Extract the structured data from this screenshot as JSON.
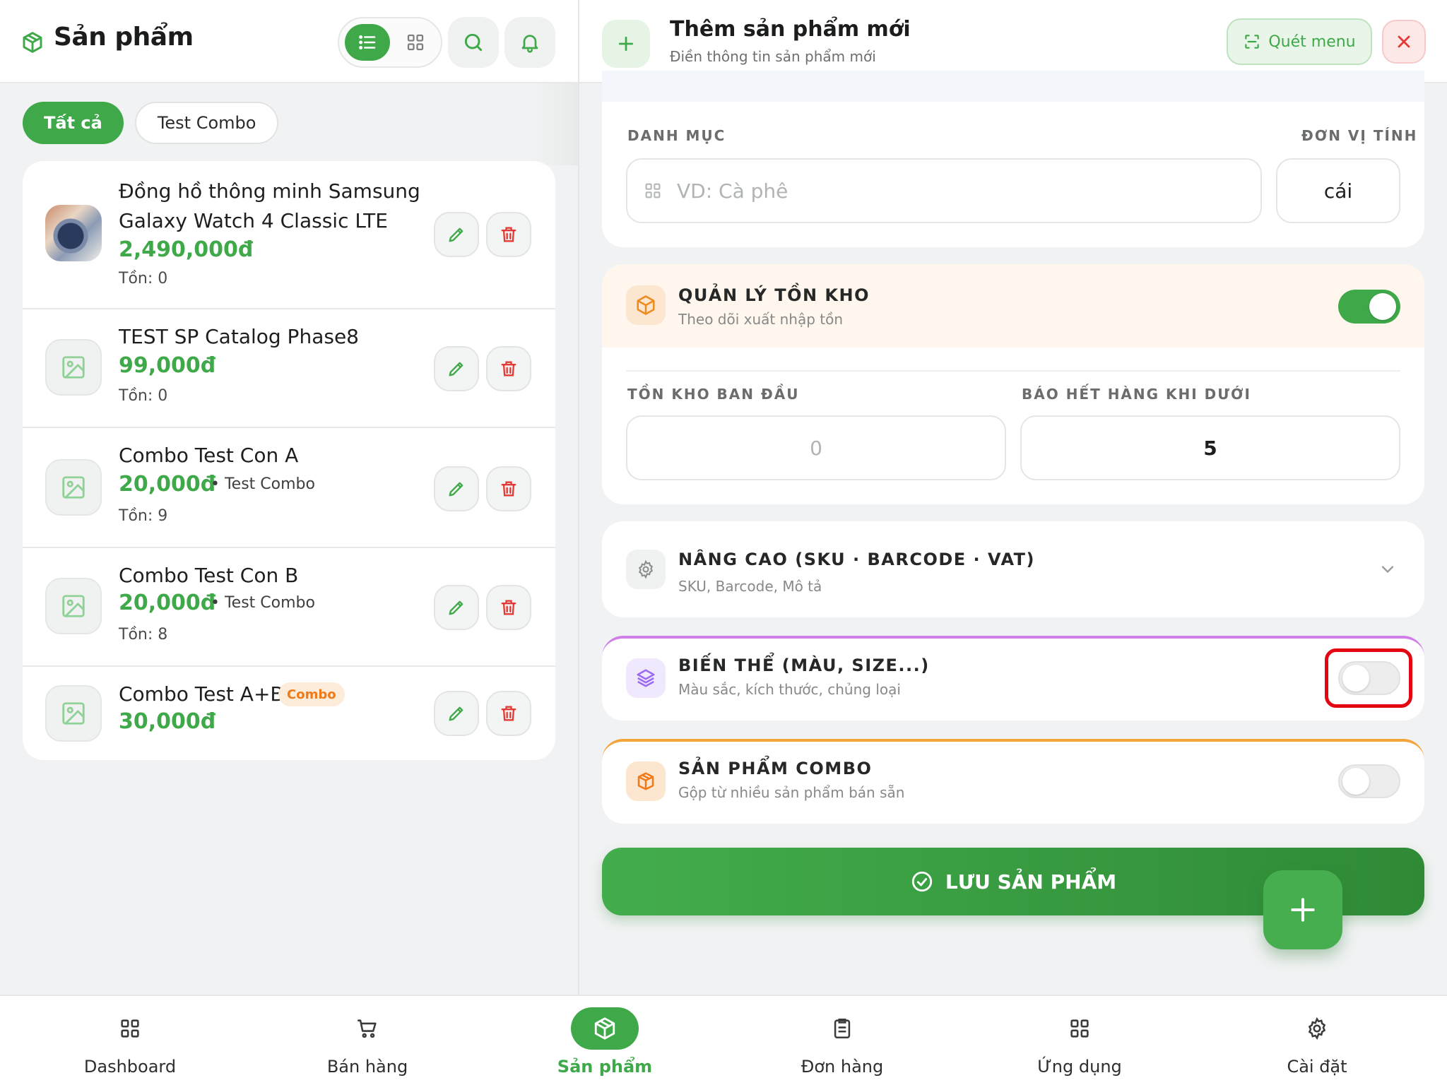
{
  "products_pane": {
    "title": "Sản phẩm",
    "filters": [
      {
        "label": "Tất cả",
        "active": true
      },
      {
        "label": "Test Combo",
        "active": false
      }
    ],
    "items": [
      {
        "name_line1": "Đồng hồ thông minh Samsung",
        "name_line2": "Galaxy Watch 4 Classic LTE",
        "price": "2,490,000đ",
        "stock": "Tồn: 0"
      },
      {
        "name": "TEST SP Catalog Phase8",
        "price": "99,000đ",
        "stock": "Tồn: 0"
      },
      {
        "name": "Combo Test Con A",
        "price": "20,000đ",
        "category": "• Test Combo",
        "stock": "Tồn: 9"
      },
      {
        "name": "Combo Test Con B",
        "price": "20,000đ",
        "category": "• Test Combo",
        "stock": "Tồn: 8"
      },
      {
        "name": "Combo Test A+B",
        "badge": "Combo",
        "price": "30,000đ"
      }
    ]
  },
  "form": {
    "title": "Thêm sản phẩm mới",
    "subtitle": "Điền thông tin sản phẩm mới",
    "scan_label": "Quét menu",
    "category_label": "DANH MỤC",
    "category_placeholder": "VD: Cà phê",
    "unit_label": "ĐƠN VỊ TÍNH",
    "unit_value": "cái",
    "stock_section": {
      "title": "QUẢN LÝ TỒN KHO",
      "subtitle": "Theo dõi xuất nhập tồn",
      "enabled": true
    },
    "initial_stock_label": "TỒN KHO BAN ĐẦU",
    "initial_stock_placeholder": "0",
    "low_stock_label": "BÁO HẾT HÀNG KHI DƯỚI",
    "low_stock_value": "5",
    "advanced": {
      "title": "NÂNG CAO (SKU · BARCODE · VAT)",
      "subtitle": "SKU, Barcode, Mô tả"
    },
    "variants": {
      "title": "BIẾN THỂ (MÀU, SIZE...)",
      "subtitle": "Màu sắc, kích thước, chủng loại",
      "enabled": false
    },
    "combo": {
      "title": "SẢN PHẨM COMBO",
      "subtitle": "Gộp từ nhiều sản phẩm bán sẵn",
      "enabled": false
    },
    "save_label": "LƯU SẢN PHẨM"
  },
  "bottom_nav": [
    {
      "label": "Dashboard",
      "icon": "grid-icon"
    },
    {
      "label": "Bán hàng",
      "icon": "cart-icon"
    },
    {
      "label": "Sản phẩm",
      "icon": "box-icon",
      "active": true
    },
    {
      "label": "Đơn hàng",
      "icon": "clipboard-icon"
    },
    {
      "label": "Ứng dụng",
      "icon": "apps-icon"
    },
    {
      "label": "Cài đặt",
      "icon": "gear-icon"
    }
  ],
  "colors": {
    "primary": "#3fa94a",
    "danger": "#e53935",
    "stock_accent": "#f08a1c",
    "variant_accent": "#9b6cf0",
    "highlight": "#e30613"
  }
}
